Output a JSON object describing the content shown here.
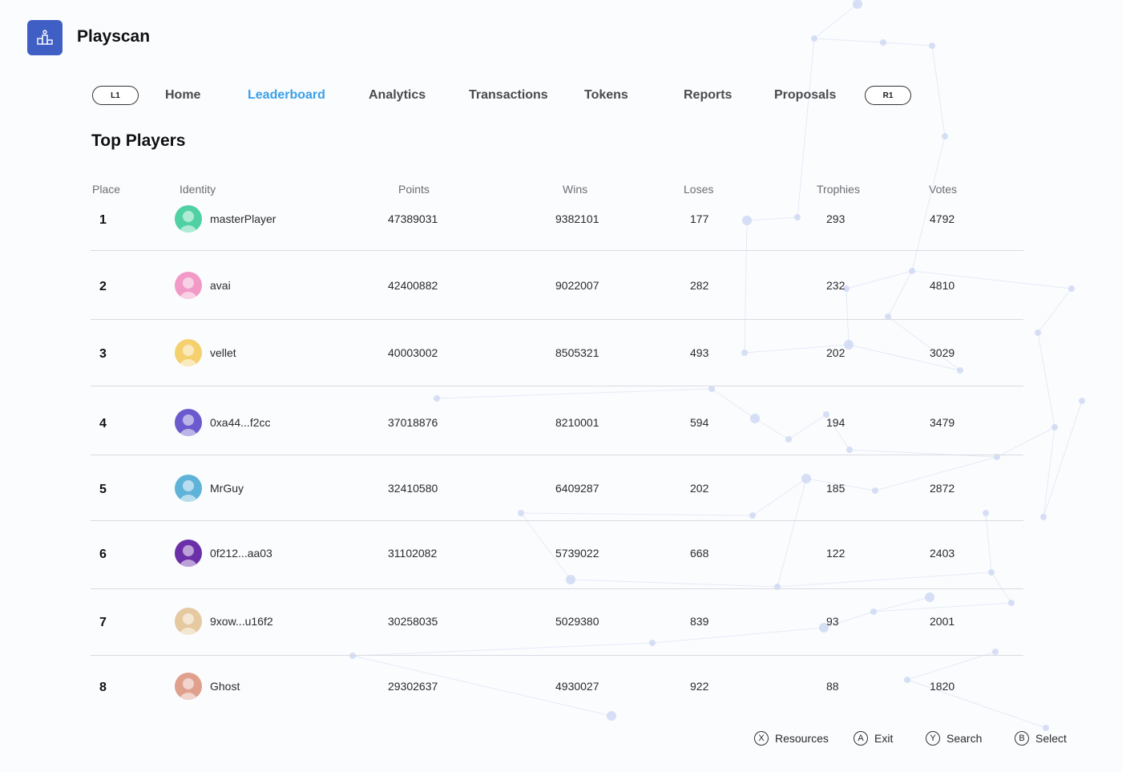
{
  "app": {
    "title": "Playscan"
  },
  "nav": {
    "left_bumper": "L1",
    "right_bumper": "R1",
    "items": [
      {
        "label": "Home",
        "active": false
      },
      {
        "label": "Leaderboard",
        "active": true
      },
      {
        "label": "Analytics",
        "active": false
      },
      {
        "label": "Transactions",
        "active": false
      },
      {
        "label": "Tokens",
        "active": false
      },
      {
        "label": "Reports",
        "active": false
      },
      {
        "label": "Proposals",
        "active": false
      }
    ]
  },
  "section": {
    "title": "Top Players"
  },
  "table": {
    "headers": [
      "Place",
      "Identity",
      "Points",
      "Wins",
      "Loses",
      "Trophies",
      "Votes"
    ],
    "rows": [
      {
        "place": "1",
        "identity": "masterPlayer",
        "points": "47389031",
        "wins": "9382101",
        "loses": "177",
        "trophies": "293",
        "votes": "4792",
        "avatar_color": "#4fd1a3"
      },
      {
        "place": "2",
        "identity": "avai",
        "points": "42400882",
        "wins": "9022007",
        "loses": "282",
        "trophies": "232",
        "votes": "4810",
        "avatar_color": "#f19ac7"
      },
      {
        "place": "3",
        "identity": "vellet",
        "points": "40003002",
        "wins": "8505321",
        "loses": "493",
        "trophies": "202",
        "votes": "3029",
        "avatar_color": "#f4d06f"
      },
      {
        "place": "4",
        "identity": "0xa44...f2cc",
        "points": "37018876",
        "wins": "8210001",
        "loses": "594",
        "trophies": "194",
        "votes": "3479",
        "avatar_color": "#6a5acd"
      },
      {
        "place": "5",
        "identity": "MrGuy",
        "points": "32410580",
        "wins": "6409287",
        "loses": "202",
        "trophies": "185",
        "votes": "2872",
        "avatar_color": "#5fb3d9"
      },
      {
        "place": "6",
        "identity": "0f212...aa03",
        "points": "31102082",
        "wins": "5739022",
        "loses": "668",
        "trophies": "122",
        "votes": "2403",
        "avatar_color": "#6b2fa8"
      },
      {
        "place": "7",
        "identity": "9xow...u16f2",
        "points": "30258035",
        "wins": "5029380",
        "loses": "839",
        "trophies": "93",
        "votes": "2001",
        "avatar_color": "#e5c9a0"
      },
      {
        "place": "8",
        "identity": "Ghost",
        "points": "29302637",
        "wins": "4930027",
        "loses": "922",
        "trophies": "88",
        "votes": "1820",
        "avatar_color": "#e0a08e"
      }
    ]
  },
  "hints": [
    {
      "button": "X",
      "label": "Resources"
    },
    {
      "button": "A",
      "label": "Exit"
    },
    {
      "button": "Y",
      "label": "Search"
    },
    {
      "button": "B",
      "label": "Select"
    }
  ],
  "colors": {
    "accent": "#3aa0e8",
    "logo": "#3f5fc4",
    "network": "#c9d6f2"
  }
}
